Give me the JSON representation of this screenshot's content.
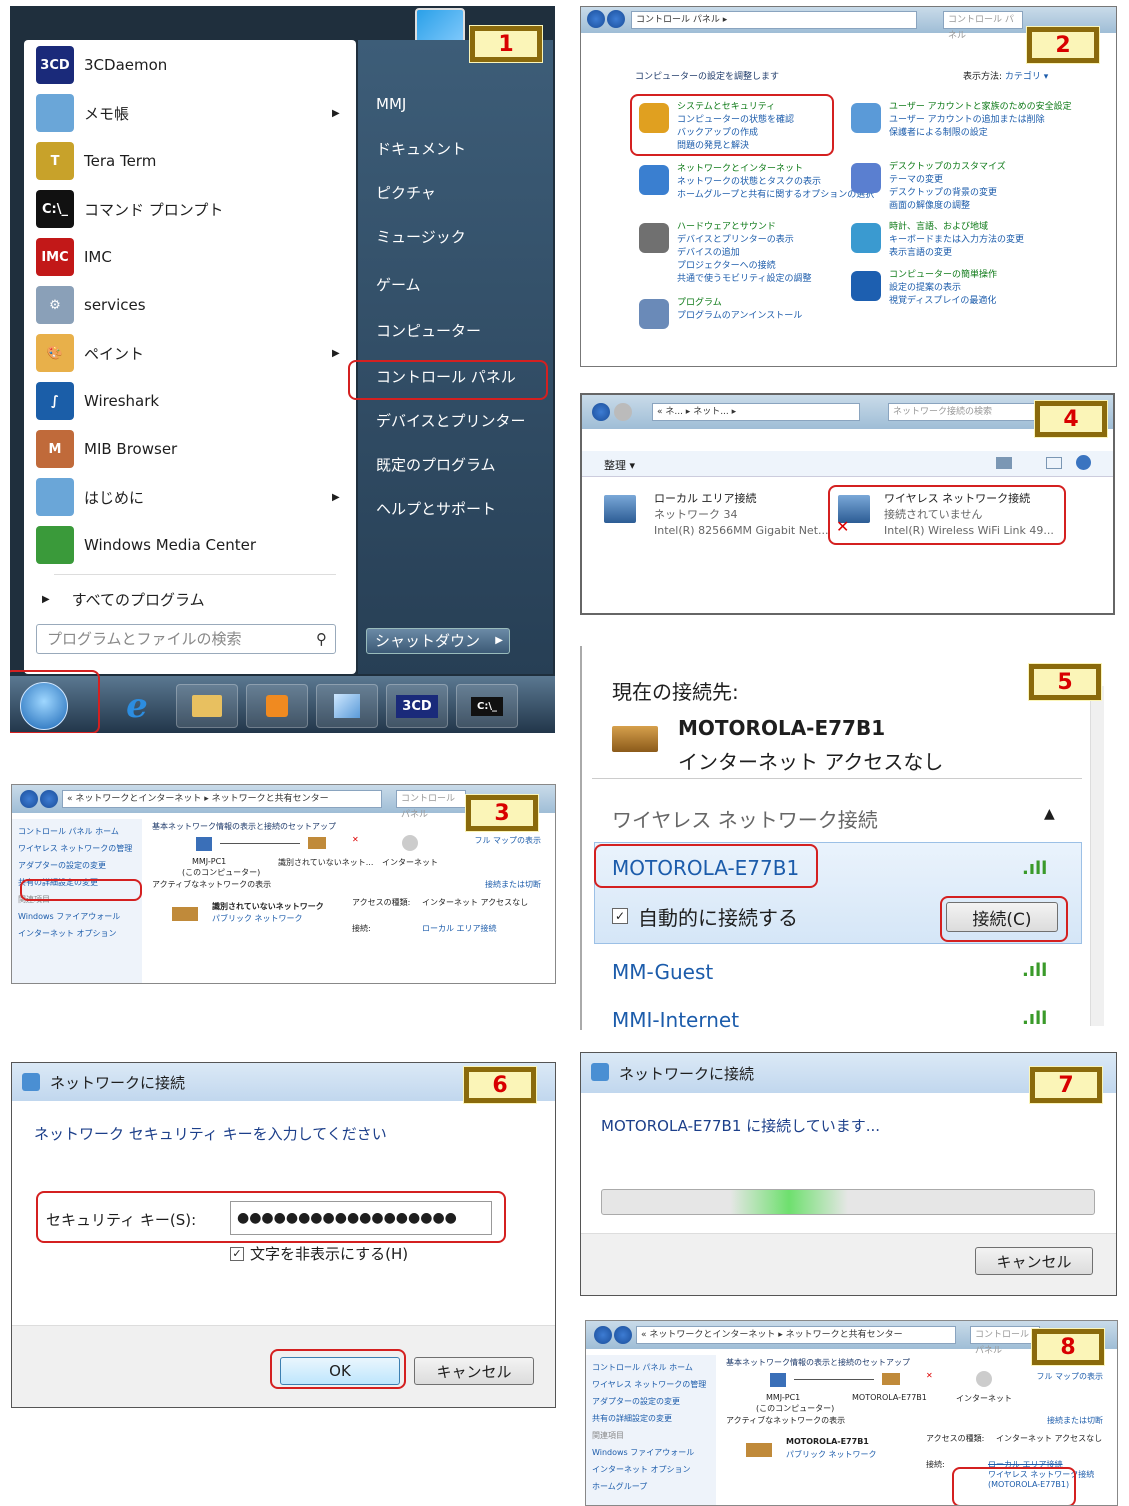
{
  "steps": [
    "1",
    "2",
    "3",
    "4",
    "5",
    "6",
    "7",
    "8"
  ],
  "start_menu": {
    "programs": [
      {
        "icon": "3cdaemon-icon",
        "icon_text": "3CD",
        "label": "3CDaemon",
        "color": "#1a2a7a"
      },
      {
        "icon": "notepad-icon",
        "icon_text": "",
        "label": "メモ帳",
        "color": "#6aa6d8",
        "submenu": true
      },
      {
        "icon": "teraterm-icon",
        "icon_text": "T",
        "label": "Tera Term",
        "color": "#c8a22a"
      },
      {
        "icon": "cmd-icon",
        "icon_text": "C:\\_",
        "label": "コマンド プロンプト",
        "color": "#111111"
      },
      {
        "icon": "imc-icon",
        "icon_text": "IMC",
        "label": "IMC",
        "color": "#c21818"
      },
      {
        "icon": "services-icon",
        "icon_text": "⚙",
        "label": "services",
        "color": "#8aa0b8"
      },
      {
        "icon": "paint-icon",
        "icon_text": "🎨",
        "label": "ペイント",
        "color": "#e8b04a",
        "submenu": true
      },
      {
        "icon": "wireshark-icon",
        "icon_text": "∫",
        "label": "Wireshark",
        "color": "#1b5ea8"
      },
      {
        "icon": "mib-browser-icon",
        "icon_text": "M",
        "label": "MIB Browser",
        "color": "#c06a3a"
      },
      {
        "icon": "getting-started-icon",
        "icon_text": "",
        "label": "はじめに",
        "color": "#6aa6d8",
        "submenu": true
      },
      {
        "icon": "media-center-icon",
        "icon_text": "",
        "label": "Windows Media Center",
        "color": "#3a9a3a"
      }
    ],
    "all_programs": "すべてのプログラム",
    "search_placeholder": "プログラムとファイルの検索",
    "right_items": [
      "MMJ",
      "ドキュメント",
      "ピクチャ",
      "ミュージック",
      "ゲーム",
      "コンピューター",
      "コントロール パネル",
      "デバイスとプリンター",
      "既定のプログラム",
      "ヘルプとサポート"
    ],
    "shutdown": "シャットダウン",
    "taskbar_3cd": "3CD",
    "taskbar_cmd": "C:\\_"
  },
  "control_panel": {
    "address": "コントロール パネル ▸",
    "search": "コントロール パネル",
    "heading": "コンピューターの設定を調整します",
    "view_by": "表示方法:",
    "view_value": "カテゴリ ▾",
    "categories": [
      {
        "title": "システムとセキュリティ",
        "links": [
          "コンピューターの状態を確認",
          "バックアップの作成",
          "問題の発見と解決"
        ]
      },
      {
        "title": "ネットワークとインターネット",
        "links": [
          "ネットワークの状態とタスクの表示",
          "ホームグループと共有に関するオプションの選択"
        ]
      },
      {
        "title": "ハードウェアとサウンド",
        "links": [
          "デバイスとプリンターの表示",
          "デバイスの追加",
          "プロジェクターへの接続",
          "共通で使うモビリティ設定の調整"
        ]
      },
      {
        "title": "プログラム",
        "links": [
          "プログラムのアンインストール"
        ]
      },
      {
        "title": "ユーザー アカウントと家族のための安全設定",
        "links": [
          "ユーザー アカウントの追加または削除",
          "保護者による制限の設定"
        ]
      },
      {
        "title": "デスクトップのカスタマイズ",
        "links": [
          "テーマの変更",
          "デスクトップの背景の変更",
          "画面の解像度の調整"
        ]
      },
      {
        "title": "時計、言語、および地域",
        "links": [
          "キーボードまたは入力方法の変更",
          "表示言語の変更"
        ]
      },
      {
        "title": "コンピューターの簡単操作",
        "links": [
          "設定の提案の表示",
          "視覚ディスプレイの最適化"
        ]
      }
    ]
  },
  "network_center": {
    "address": "« ネットワークとインターネット ▸ ネットワークと共有センター",
    "search": "コントロール パネル",
    "side": [
      "コントロール パネル ホーム",
      "ワイヤレス ネットワークの管理",
      "アダプターの設定の変更",
      "共有の詳細設定の変更",
      "関連項目",
      "Windows ファイアウォール",
      "インターネット オプション",
      "ホームグループ"
    ],
    "heading": "基本ネットワーク情報の表示と接続のセットアップ",
    "full_map": "フル マップの表示",
    "pc": "MMJ-PC1",
    "pc_sub": "(このコンピューター)",
    "unidentified": "識別されていないネット...",
    "internet": "インターネット",
    "active": "アクティブなネットワークの表示",
    "connect_link": "接続または切断",
    "net_name": "識別されていないネットワーク",
    "net_type": "パブリック ネットワーク",
    "access_label": "アクセスの種類:",
    "access_value": "インターネット アクセスなし",
    "conn_label": "接続:",
    "conn_value": "ローカル エリア接続",
    "net8": "MOTOROLA-E77B1",
    "conn8_a": "ローカル エリア接続",
    "conn8_b": "ワイヤレス ネットワーク接続 (MOTOROLA-E77B1)"
  },
  "adapters": {
    "address": "« ネ... ▸ ネット... ▸",
    "search": "ネットワーク接続の検索",
    "organize": "整理 ▾",
    "lan": {
      "name": "ローカル エリア接続",
      "status": "ネットワーク 34",
      "device": "Intel(R) 82566MM Gigabit Net..."
    },
    "wlan": {
      "name": "ワイヤレス ネットワーク接続",
      "status": "接続されていません",
      "device": "Intel(R) Wireless WiFi Link 49..."
    }
  },
  "wifi": {
    "current": "現在の接続先:",
    "ssid": "MOTOROLA-E77B1",
    "no_access": "インターネット アクセスなし",
    "section": "ワイヤレス ネットワーク接続",
    "selected": "MOTOROLA-E77B1",
    "auto": "自動的に接続する",
    "connect": "接続(C)",
    "others": [
      "MM-Guest",
      "MMI-Internet"
    ]
  },
  "dialog_key": {
    "title": "ネットワークに接続",
    "prompt": "ネットワーク セキュリティ キーを入力してください",
    "label": "セキュリティ キー(S):",
    "value": "●●●●●●●●●●●●●●●●●●",
    "hide": "文字を非表示にする(H)",
    "ok": "OK",
    "cancel": "キャンセル"
  },
  "dialog_connecting": {
    "title": "ネットワークに接続",
    "message": "MOTOROLA-E77B1 に接続しています...",
    "cancel": "キャンセル"
  }
}
